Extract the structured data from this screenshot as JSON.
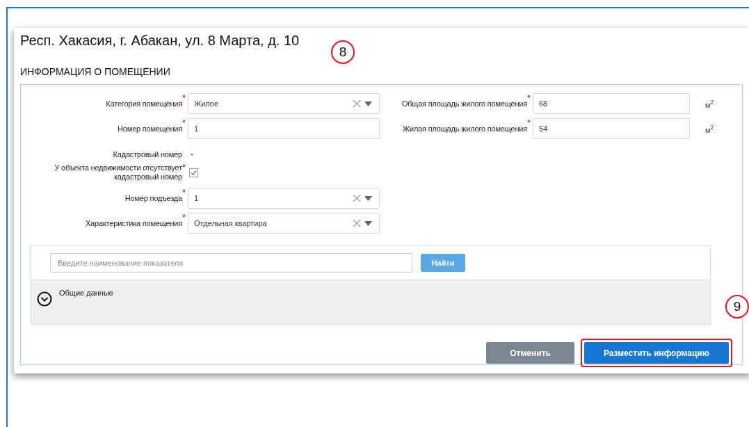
{
  "address": "Респ. Хакасия, г. Абакан, ул. 8 Марта, д. 10",
  "section_title": "ИНФОРМАЦИЯ О ПОМЕЩЕНИИ",
  "left_fields": [
    {
      "kind": "select",
      "label": "Категория помещения",
      "required_mark": "*",
      "value": "Жилое"
    },
    {
      "kind": "text",
      "label": "Номер помещения",
      "required_mark": "*",
      "value": "1"
    },
    {
      "kind": "readonly",
      "label": "Кадастровый номер",
      "value": "-"
    },
    {
      "kind": "checkbox",
      "label": "У объекта недвижимости отсутствует кадастровый номер",
      "required_mark": "*",
      "checked": true
    },
    {
      "kind": "select",
      "label": "Номер подъезда",
      "required_mark": "*",
      "value": "1"
    },
    {
      "kind": "select",
      "label": "Характеристика помещения",
      "required_mark": "*",
      "value": "Отдельная квартира"
    }
  ],
  "right_fields": [
    {
      "label": "Общая площадь жилого помещения",
      "required_mark": "*",
      "value": "68",
      "unit": "м$^{2}$"
    },
    {
      "label": "Жилая площадь жилого помещения",
      "required_mark": "*",
      "value": "54",
      "unit": "м$^{2}$"
    }
  ],
  "search": {
    "placeholder": "Введите наименование показателя",
    "button": "Найти"
  },
  "accordion": {
    "label": "Общие данные",
    "expanded": false
  },
  "buttons": [
    {
      "kind": "secondary",
      "label": "Отменить",
      "highlighted": false
    },
    {
      "kind": "primary",
      "label": "Разместить информацию",
      "highlighted": true
    }
  ],
  "markers": [
    "8",
    "9"
  ]
}
